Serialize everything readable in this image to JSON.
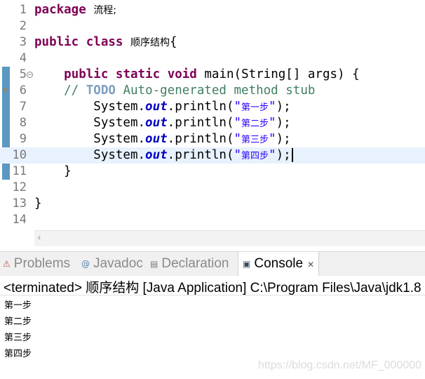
{
  "editor": {
    "line_numbers": [
      "1",
      "2",
      "3",
      "4",
      "5",
      "6",
      "7",
      "8",
      "9",
      "10",
      "11",
      "12",
      "13",
      "14"
    ],
    "package_kw": "package",
    "package_name": "流程;",
    "public_kw": "public",
    "class_kw": "class",
    "class_name": "顺序结构",
    "open_brace": "{",
    "method_indent": "    ",
    "method_public": "public",
    "method_static": "static",
    "method_void": "void",
    "method_sig": "main(String[] args) {",
    "comment_prefix": "    // ",
    "todo": "TODO",
    "comment_text": " Auto-generated method stub",
    "println_prefix": "        System.",
    "println_field": "out",
    "println_call": ".println(",
    "quote": "\"",
    "println_end": ");",
    "strings": [
      "第一步",
      "第二步",
      "第三步",
      "第四步"
    ],
    "close_method": "    }",
    "close_class": "}"
  },
  "tabs": [
    {
      "label": "Problems",
      "icon": "problems-icon",
      "glyph": "⚠"
    },
    {
      "label": "Javadoc",
      "icon": "javadoc-icon",
      "glyph": "@"
    },
    {
      "label": "Declaration",
      "icon": "declaration-icon",
      "glyph": "▤"
    },
    {
      "label": "Console",
      "icon": "console-icon",
      "glyph": "▣",
      "active": true
    }
  ],
  "console": {
    "status": "<terminated> 顺序结构 [Java Application] C:\\Program Files\\Java\\jdk1.8",
    "output": [
      "第一步",
      "第二步",
      "第三步",
      "第四步"
    ]
  },
  "watermark": "https://blog.csdn.net/MF_000000",
  "colors": {
    "keyword": "#7f0055",
    "comment": "#3f7f5f",
    "todo": "#7f9fbf",
    "string": "#2a00ff",
    "field": "#0000c0",
    "current_line": "#e8f2fe"
  }
}
